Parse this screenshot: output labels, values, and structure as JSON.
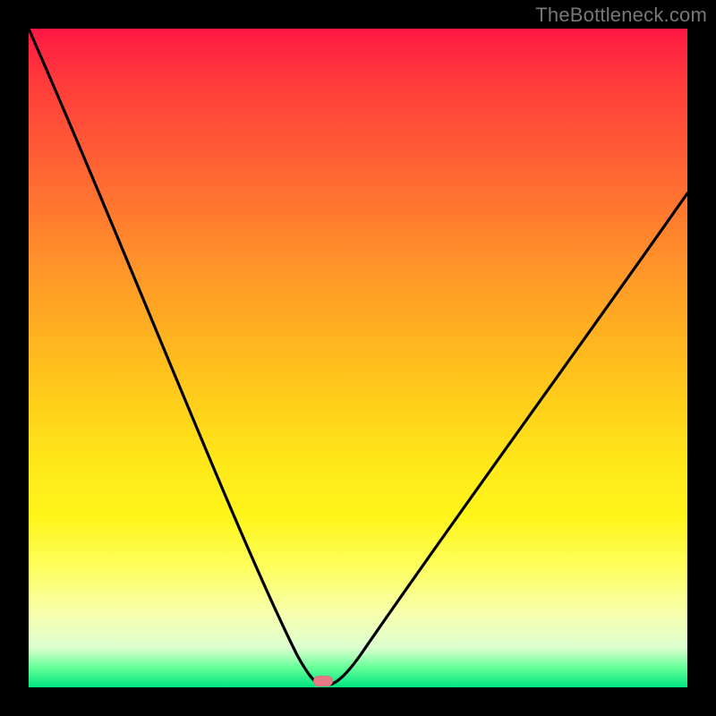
{
  "watermark": "TheBottleneck.com",
  "colors": {
    "frame": "#000000",
    "curve": "#000000",
    "marker": "#e67a84",
    "gradient_stops": [
      "#ff1744",
      "#ff3b3b",
      "#ff5a36",
      "#ff7a2f",
      "#ff9a28",
      "#ffb61f",
      "#ffd21a",
      "#ffe81a",
      "#fff51a",
      "#fdff60",
      "#f7ffb0",
      "#dcffd0",
      "#66ff99",
      "#00e582"
    ]
  },
  "chart_data": {
    "type": "line",
    "title": "",
    "xlabel": "",
    "ylabel": "",
    "xlim": [
      0,
      100
    ],
    "ylim": [
      0,
      100
    ],
    "grid": false,
    "legend": false,
    "x": [
      0,
      5,
      10,
      15,
      20,
      25,
      30,
      35,
      38,
      40,
      42,
      44,
      45,
      46,
      48,
      50,
      55,
      60,
      65,
      70,
      75,
      80,
      85,
      90,
      95,
      100
    ],
    "values": [
      100,
      87,
      73,
      60,
      47,
      35,
      23,
      12,
      6,
      2.5,
      0.8,
      0.1,
      0,
      0.1,
      0.8,
      2.5,
      9,
      17,
      25,
      33,
      41,
      49,
      56,
      63,
      69,
      75
    ],
    "minimum_x": 45,
    "marker": {
      "x": 45,
      "y": 0
    }
  }
}
